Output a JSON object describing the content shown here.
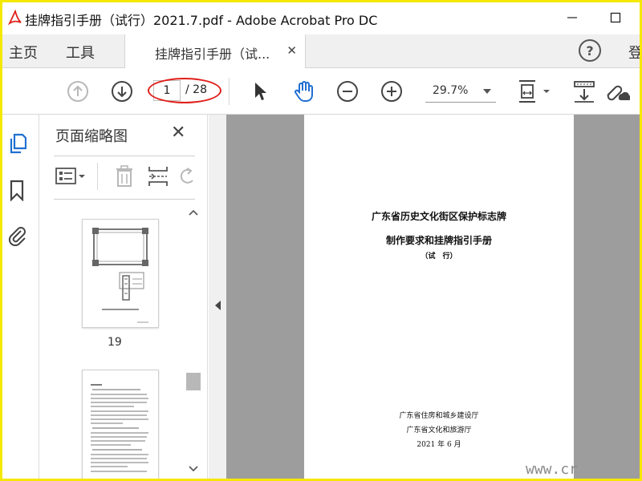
{
  "window": {
    "title": "挂牌指引手册（试行）2021.7.pdf - Adobe Acrobat Pro DC",
    "minimize_glyph": "—",
    "maximize_glyph": "☐"
  },
  "menu": {
    "home": "主页",
    "tools": "工具",
    "doc_tab": "挂牌指引手册（试...",
    "doc_tab_close": "✕",
    "help": "?",
    "login": "登"
  },
  "toolbar": {
    "current_page": "1",
    "total_pages": "/ 28",
    "zoom": "29.7%"
  },
  "thumbnails": {
    "title": "页面缩略图",
    "close": "✕",
    "page_labels": [
      "19"
    ]
  },
  "document": {
    "title_line1": "广东省历史文化街区保护标志牌",
    "title_line2": "制作要求和挂牌指引手册",
    "subtitle": "（试　行）",
    "org1": "广东省住房和城乡建设厅",
    "org2": "广东省文化和旅游厅",
    "date": "2021 年 6 月"
  },
  "watermark": "www.cr",
  "colors": {
    "border": "#f5e800",
    "highlight_oval": "#e0201b",
    "hand_tool": "#1f6fd1",
    "sidebar_active": "#1f6fd1",
    "doc_background": "#9d9d9d"
  },
  "icons": {
    "app_logo": "acrobat-logo-icon",
    "prev_page": "arrow-up-circle-icon",
    "next_page": "arrow-down-circle-icon",
    "select": "cursor-icon",
    "hand": "hand-icon",
    "zoom_out": "minus-circle-icon",
    "zoom_in": "plus-circle-icon",
    "fit_page": "fit-page-icon",
    "scroll_mode": "scroll-mode-icon",
    "share_link": "share-link-icon",
    "thumbnails": "thumbnails-icon",
    "bookmarks": "bookmark-icon",
    "attachments": "paperclip-icon",
    "options": "options-list-icon",
    "delete": "trash-icon",
    "insert": "insert-page-icon",
    "rotate": "rotate-icon"
  }
}
